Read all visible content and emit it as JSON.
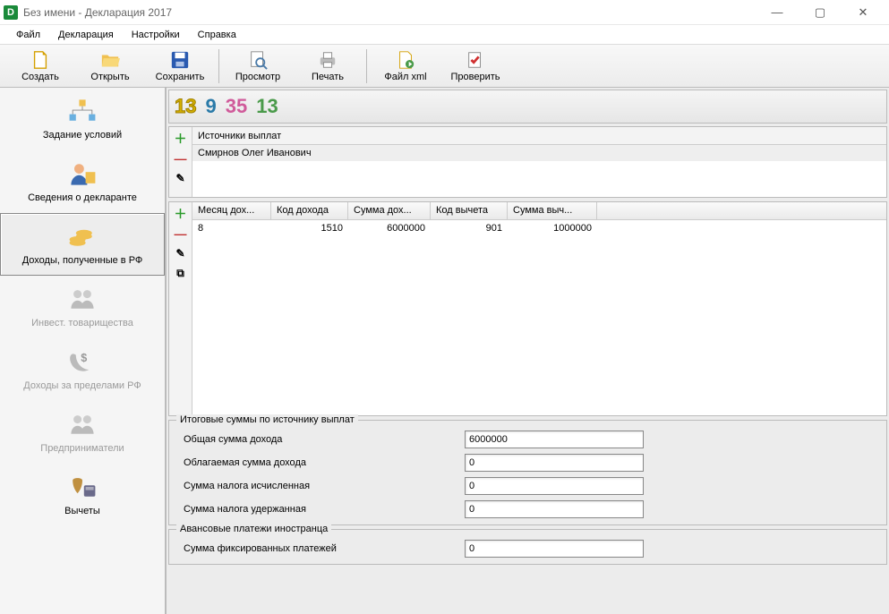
{
  "window": {
    "title": "Без имени - Декларация 2017"
  },
  "menu": {
    "file": "Файл",
    "decl": "Декларация",
    "settings": "Настройки",
    "help": "Справка"
  },
  "toolbar": {
    "create": "Создать",
    "open": "Открыть",
    "save": "Сохранить",
    "preview": "Просмотр",
    "print": "Печать",
    "xml": "Файл xml",
    "check": "Проверить"
  },
  "sidebar": {
    "cond": "Задание условий",
    "decl": "Сведения о декларанте",
    "rf": "Доходы, полученные в РФ",
    "invest": "Инвест. товарищества",
    "abroad": "Доходы за пределами РФ",
    "ent": "Предприниматели",
    "ded": "Вычеты"
  },
  "rates": {
    "a": "13",
    "b": "9",
    "c": "35",
    "d": "13"
  },
  "sources": {
    "header": "Источники выплат",
    "item1": "Смирнов Олег Иванович"
  },
  "records": {
    "cols": {
      "month": "Месяц дох...",
      "code": "Код дохода",
      "sum": "Сумма дох...",
      "vcode": "Код вычета",
      "vsum": "Сумма выч..."
    },
    "row1": {
      "month": "8",
      "code": "1510",
      "sum": "6000000",
      "vcode": "901",
      "vsum": "1000000"
    }
  },
  "totals": {
    "title": "Итоговые суммы по источнику выплат",
    "total_label": "Общая сумма дохода",
    "total_val": "6000000",
    "taxable_label": "Облагаемая сумма дохода",
    "taxable_val": "0",
    "calc_label": "Сумма налога исчисленная",
    "calc_val": "0",
    "with_label": "Сумма налога удержанная",
    "with_val": "0"
  },
  "advance": {
    "title": "Авансовые платежи иностранца",
    "fixed_label": "Сумма фиксированных платежей",
    "fixed_val": "0"
  }
}
